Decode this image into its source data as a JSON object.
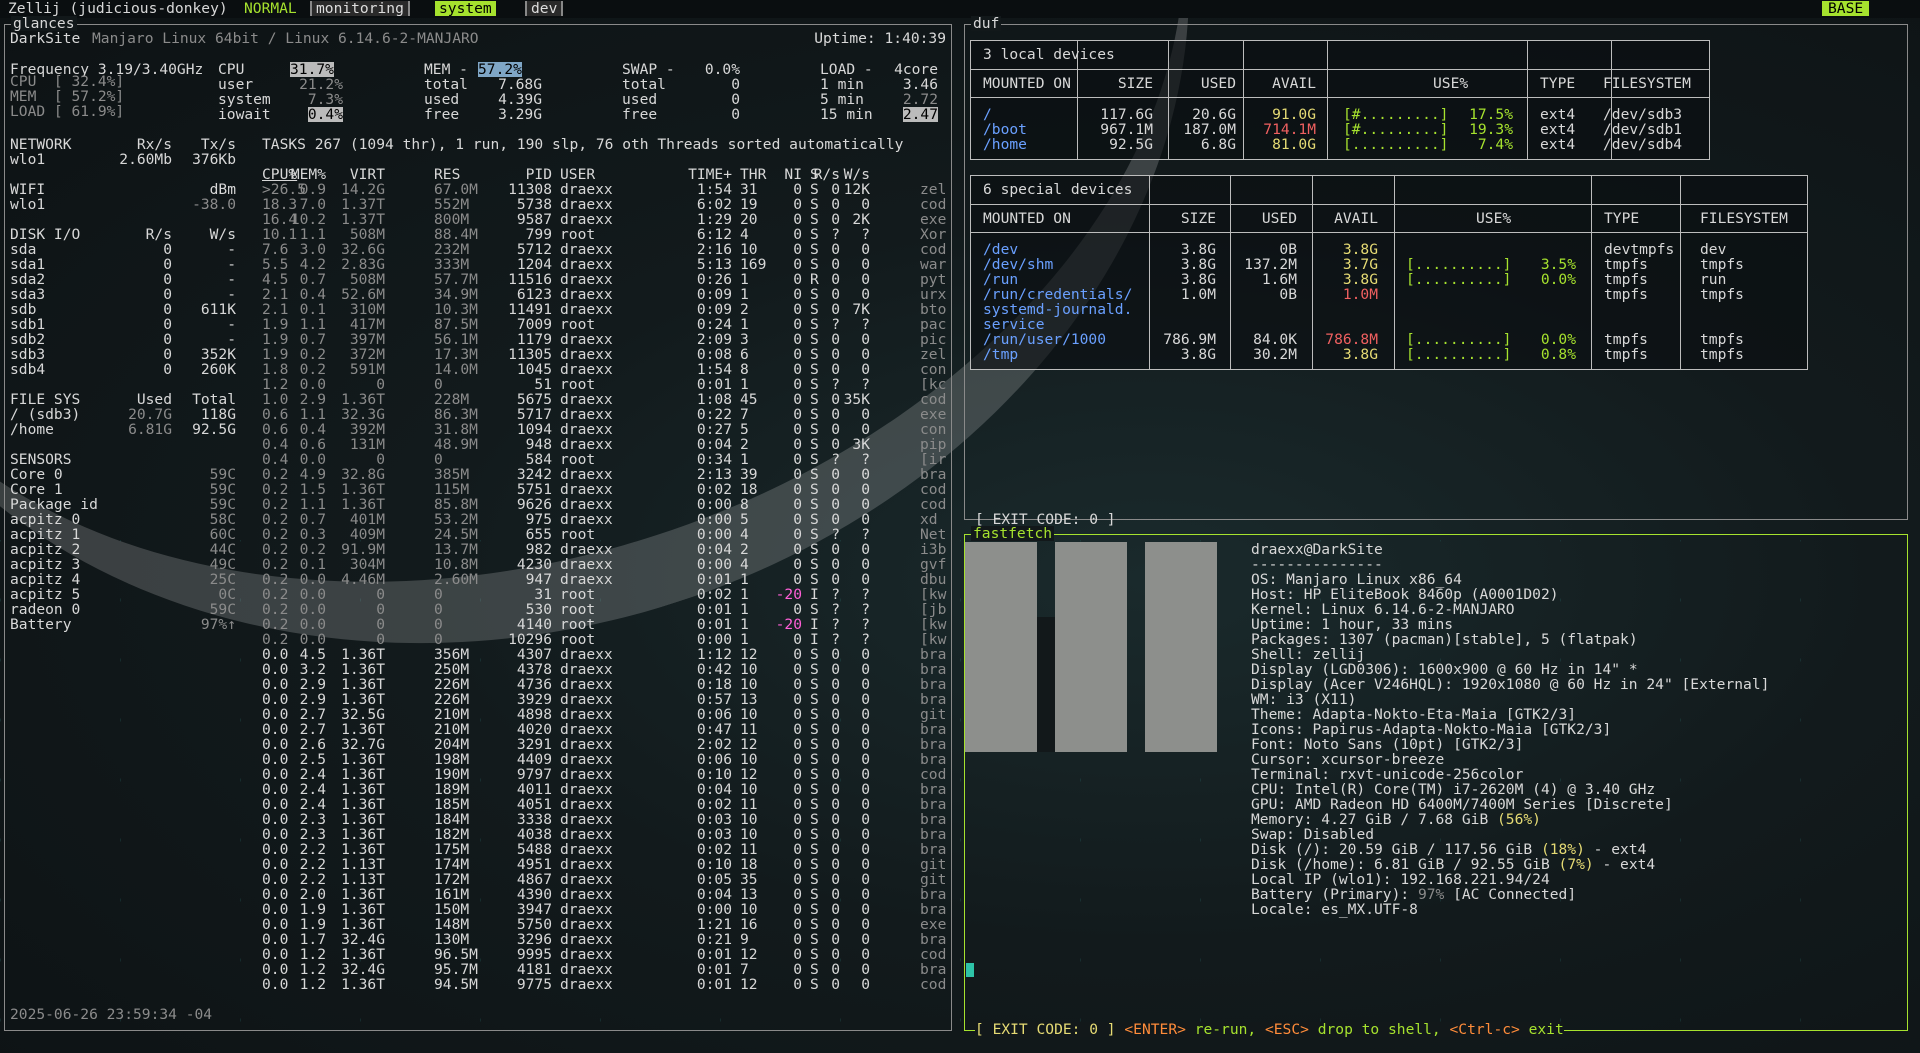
{
  "topbar": {
    "session": "Zellij (judicious-donkey)",
    "mode": "NORMAL",
    "tabs": [
      "monitoring",
      "system",
      "dev"
    ],
    "active_tab": "system",
    "layout_badge": "BASE"
  },
  "panes": {
    "glances": "glances",
    "duf": "duf",
    "fastfetch": "fastfetch",
    "exit_code_top": "[ EXIT CODE: 0 ]",
    "exit_code_bottom": {
      "prefix": "[ EXIT CODE: 0 ]",
      "enter": "<ENTER>",
      "rerun": " re-run, ",
      "esc": "<ESC>",
      "drop": " drop to shell, ",
      "ctrlc": "<Ctrl-c>",
      "exit": " exit"
    }
  },
  "glances": {
    "header_left": "DarkSite",
    "header_os": "Manjaro Linux 64bit / Linux 6.14.6-2-MANJARO",
    "uptime": "Uptime: 1:40:39",
    "quicklook": [
      {
        "label": "Frequency 3.19/3.40GHz"
      },
      {
        "label": "CPU  [ 32.4%]"
      },
      {
        "label": "MEM  [ 57.2%]"
      },
      {
        "label": "LOAD [ 61.9%]"
      }
    ],
    "cpu": {
      "title": "CPU",
      "value": "31.7%",
      "rows": [
        [
          "user",
          "21.2%"
        ],
        [
          "system",
          "7.3%"
        ],
        [
          "iowait",
          "0.4%"
        ]
      ]
    },
    "mem": {
      "title": "MEM -",
      "value": "57.2%",
      "rows": [
        [
          "total",
          "7.68G"
        ],
        [
          "used",
          "4.39G"
        ],
        [
          "free",
          "3.29G"
        ]
      ]
    },
    "swap": {
      "title": "SWAP -",
      "value": "0.0%",
      "rows": [
        [
          "total",
          "0"
        ],
        [
          "used",
          "0"
        ],
        [
          "free",
          "0"
        ]
      ]
    },
    "load": {
      "title": "LOAD -",
      "cores": "4core",
      "rows": [
        [
          "1 min",
          "3.46"
        ],
        [
          "5 min",
          "2.72"
        ],
        [
          "15 min",
          "2.47"
        ]
      ]
    },
    "network": {
      "title": "NETWORK",
      "rx": "Rx/s",
      "tx": "Tx/s",
      "rows": [
        [
          "wlo1",
          "2.60Mb",
          "376Kb"
        ]
      ]
    },
    "wifi": {
      "title": "WIFI",
      "unit": "dBm",
      "rows": [
        [
          "wlo1",
          "-38.0"
        ]
      ]
    },
    "diskio": {
      "title": "DISK I/O",
      "r": "R/s",
      "w": "W/s",
      "rows": [
        [
          "sda",
          "0",
          "-"
        ],
        [
          "sda1",
          "0",
          "-"
        ],
        [
          "sda2",
          "0",
          "-"
        ],
        [
          "sda3",
          "0",
          "-"
        ],
        [
          "sdb",
          "0",
          "611K"
        ],
        [
          "sdb1",
          "0",
          "-"
        ],
        [
          "sdb2",
          "0",
          "-"
        ],
        [
          "sdb3",
          "0",
          "352K"
        ],
        [
          "sdb4",
          "0",
          "260K"
        ]
      ]
    },
    "filesys": {
      "title": "FILE SYS",
      "used": "Used",
      "total": "Total",
      "rows": [
        [
          "/ (sdb3)",
          "20.7G",
          "118G"
        ],
        [
          "/home",
          "6.81G",
          "92.5G"
        ]
      ]
    },
    "sensors": {
      "title": "SENSORS",
      "rows": [
        [
          "Core 0",
          "59C"
        ],
        [
          "Core 1",
          "59C"
        ],
        [
          "Package id",
          "59C"
        ],
        [
          "acpitz 0",
          "58C"
        ],
        [
          "acpitz 1",
          "60C"
        ],
        [
          "acpitz 2",
          "44C"
        ],
        [
          "acpitz 3",
          "49C"
        ],
        [
          "acpitz 4",
          "25C"
        ],
        [
          "acpitz 5",
          "0C"
        ],
        [
          "radeon 0",
          "59C"
        ],
        [
          "Battery",
          "97%↑"
        ]
      ]
    },
    "datetime": "2025-06-26 23:59:34 -04",
    "tasks_line": "TASKS 267 (1094 thr), 1 run, 190 slp, 76 oth Threads sorted automatically",
    "proc_headers": [
      "CPU%",
      "MEM%",
      "VIRT",
      "RES",
      "PID",
      "USER",
      "TIME+",
      "THR",
      "NI",
      "S",
      "R/s",
      "W/s"
    ],
    "procs": [
      [
        ">26.5",
        "0.9",
        "14.2G",
        "67.0M",
        "11308",
        "draexx",
        "1:54",
        "31",
        "0",
        "S",
        "0",
        "12K",
        "zel"
      ],
      [
        "18.3",
        "7.0",
        "1.37T",
        "552M",
        "5738",
        "draexx",
        "6:02",
        "19",
        "0",
        "S",
        "0",
        "0",
        "cod"
      ],
      [
        "16.4",
        "10.2",
        "1.37T",
        "800M",
        "9587",
        "draexx",
        "1:29",
        "20",
        "0",
        "S",
        "0",
        "2K",
        "exe"
      ],
      [
        "10.1",
        "1.1",
        "508M",
        "88.4M",
        "799",
        "root",
        "6:12",
        "4",
        "0",
        "S",
        "?",
        "?",
        "Xor"
      ],
      [
        "7.6",
        "3.0",
        "32.6G",
        "232M",
        "5712",
        "draexx",
        "2:16",
        "10",
        "0",
        "S",
        "0",
        "0",
        "cod"
      ],
      [
        "5.5",
        "4.2",
        "2.83G",
        "333M",
        "1204",
        "draexx",
        "5:13",
        "169",
        "0",
        "S",
        "0",
        "0",
        "war"
      ],
      [
        "4.5",
        "0.7",
        "508M",
        "57.7M",
        "11516",
        "draexx",
        "0:26",
        "1",
        "0",
        "R",
        "0",
        "0",
        "pyt"
      ],
      [
        "2.1",
        "0.4",
        "52.6M",
        "34.9M",
        "6123",
        "draexx",
        "0:09",
        "1",
        "0",
        "S",
        "0",
        "0",
        "urx"
      ],
      [
        "2.1",
        "0.1",
        "310M",
        "10.3M",
        "11491",
        "draexx",
        "0:09",
        "2",
        "0",
        "S",
        "0",
        "7K",
        "bto"
      ],
      [
        "1.9",
        "1.1",
        "417M",
        "87.5M",
        "7009",
        "root",
        "0:24",
        "1",
        "0",
        "S",
        "?",
        "?",
        "pac"
      ],
      [
        "1.9",
        "0.7",
        "397M",
        "56.1M",
        "1179",
        "draexx",
        "2:09",
        "3",
        "0",
        "S",
        "0",
        "0",
        "pic"
      ],
      [
        "1.9",
        "0.2",
        "372M",
        "17.3M",
        "11305",
        "draexx",
        "0:08",
        "6",
        "0",
        "S",
        "0",
        "0",
        "zel"
      ],
      [
        "1.8",
        "0.2",
        "591M",
        "14.0M",
        "1045",
        "draexx",
        "1:54",
        "8",
        "0",
        "S",
        "0",
        "0",
        "con"
      ],
      [
        "1.2",
        "0.0",
        "0",
        "0",
        "51",
        "root",
        "0:01",
        "1",
        "0",
        "S",
        "?",
        "?",
        "[kc"
      ],
      [
        "1.0",
        "2.9",
        "1.36T",
        "228M",
        "5675",
        "draexx",
        "1:08",
        "45",
        "0",
        "S",
        "0",
        "35K",
        "cod"
      ],
      [
        "0.6",
        "1.1",
        "32.3G",
        "86.3M",
        "5717",
        "draexx",
        "0:22",
        "7",
        "0",
        "S",
        "0",
        "0",
        "exe"
      ],
      [
        "0.6",
        "0.4",
        "392M",
        "31.8M",
        "1094",
        "draexx",
        "0:27",
        "5",
        "0",
        "S",
        "0",
        "0",
        "con"
      ],
      [
        "0.4",
        "0.6",
        "131M",
        "48.9M",
        "948",
        "draexx",
        "0:04",
        "2",
        "0",
        "S",
        "0",
        "3K",
        "pip"
      ],
      [
        "0.4",
        "0.0",
        "0",
        "0",
        "584",
        "root",
        "0:34",
        "1",
        "0",
        "S",
        "?",
        "?",
        "[ir"
      ],
      [
        "0.2",
        "4.9",
        "32.8G",
        "385M",
        "3242",
        "draexx",
        "2:13",
        "39",
        "0",
        "S",
        "0",
        "0",
        "bra"
      ],
      [
        "0.2",
        "1.5",
        "1.36T",
        "115M",
        "5751",
        "draexx",
        "0:02",
        "18",
        "0",
        "S",
        "0",
        "0",
        "cod"
      ],
      [
        "0.2",
        "1.1",
        "1.36T",
        "85.8M",
        "9626",
        "draexx",
        "0:00",
        "8",
        "0",
        "S",
        "0",
        "0",
        "cod"
      ],
      [
        "0.2",
        "0.7",
        "401M",
        "53.2M",
        "975",
        "draexx",
        "0:00",
        "5",
        "0",
        "S",
        "0",
        "0",
        "xd"
      ],
      [
        "0.2",
        "0.3",
        "409M",
        "24.5M",
        "655",
        "root",
        "0:00",
        "4",
        "0",
        "S",
        "?",
        "?",
        "Net"
      ],
      [
        "0.2",
        "0.2",
        "91.9M",
        "13.7M",
        "982",
        "draexx",
        "0:04",
        "2",
        "0",
        "S",
        "0",
        "0",
        "i3b"
      ],
      [
        "0.2",
        "0.1",
        "304M",
        "10.8M",
        "4230",
        "draexx",
        "0:00",
        "4",
        "0",
        "S",
        "0",
        "0",
        "gvf"
      ],
      [
        "0.2",
        "0.0",
        "4.46M",
        "2.60M",
        "947",
        "draexx",
        "0:01",
        "1",
        "0",
        "S",
        "0",
        "0",
        "dbu"
      ],
      [
        "0.2",
        "0.0",
        "0",
        "0",
        "31",
        "root",
        "0:02",
        "1",
        "-20",
        "I",
        "?",
        "?",
        "[kw"
      ],
      [
        "0.2",
        "0.0",
        "0",
        "0",
        "530",
        "root",
        "0:01",
        "1",
        "0",
        "S",
        "?",
        "?",
        "[jb"
      ],
      [
        "0.2",
        "0.0",
        "0",
        "0",
        "4140",
        "root",
        "0:01",
        "1",
        "-20",
        "I",
        "?",
        "?",
        "[kw"
      ],
      [
        "0.2",
        "0.0",
        "0",
        "0",
        "10296",
        "root",
        "0:00",
        "1",
        "0",
        "I",
        "?",
        "?",
        "[kw"
      ],
      [
        "0.0",
        "4.5",
        "1.36T",
        "356M",
        "4307",
        "draexx",
        "1:12",
        "12",
        "0",
        "S",
        "0",
        "0",
        "bra"
      ],
      [
        "0.0",
        "3.2",
        "1.36T",
        "250M",
        "4378",
        "draexx",
        "0:42",
        "10",
        "0",
        "S",
        "0",
        "0",
        "bra"
      ],
      [
        "0.0",
        "2.9",
        "1.36T",
        "226M",
        "4736",
        "draexx",
        "0:18",
        "10",
        "0",
        "S",
        "0",
        "0",
        "bra"
      ],
      [
        "0.0",
        "2.9",
        "1.36T",
        "226M",
        "3929",
        "draexx",
        "0:57",
        "13",
        "0",
        "S",
        "0",
        "0",
        "bra"
      ],
      [
        "0.0",
        "2.7",
        "32.5G",
        "210M",
        "4898",
        "draexx",
        "0:06",
        "10",
        "0",
        "S",
        "0",
        "0",
        "git"
      ],
      [
        "0.0",
        "2.7",
        "1.36T",
        "210M",
        "4020",
        "draexx",
        "0:47",
        "11",
        "0",
        "S",
        "0",
        "0",
        "bra"
      ],
      [
        "0.0",
        "2.6",
        "32.7G",
        "204M",
        "3291",
        "draexx",
        "2:02",
        "12",
        "0",
        "S",
        "0",
        "0",
        "bra"
      ],
      [
        "0.0",
        "2.5",
        "1.36T",
        "198M",
        "4409",
        "draexx",
        "0:06",
        "10",
        "0",
        "S",
        "0",
        "0",
        "bra"
      ],
      [
        "0.0",
        "2.4",
        "1.36T",
        "190M",
        "9797",
        "draexx",
        "0:10",
        "12",
        "0",
        "S",
        "0",
        "0",
        "cod"
      ],
      [
        "0.0",
        "2.4",
        "1.36T",
        "189M",
        "4011",
        "draexx",
        "0:04",
        "10",
        "0",
        "S",
        "0",
        "0",
        "bra"
      ],
      [
        "0.0",
        "2.4",
        "1.36T",
        "185M",
        "4051",
        "draexx",
        "0:02",
        "11",
        "0",
        "S",
        "0",
        "0",
        "bra"
      ],
      [
        "0.0",
        "2.3",
        "1.36T",
        "184M",
        "3338",
        "draexx",
        "0:03",
        "10",
        "0",
        "S",
        "0",
        "0",
        "bra"
      ],
      [
        "0.0",
        "2.3",
        "1.36T",
        "182M",
        "4038",
        "draexx",
        "0:03",
        "10",
        "0",
        "S",
        "0",
        "0",
        "bra"
      ],
      [
        "0.0",
        "2.2",
        "1.36T",
        "175M",
        "5488",
        "draexx",
        "0:02",
        "11",
        "0",
        "S",
        "0",
        "0",
        "bra"
      ],
      [
        "0.0",
        "2.2",
        "1.13T",
        "174M",
        "4951",
        "draexx",
        "0:10",
        "18",
        "0",
        "S",
        "0",
        "0",
        "git"
      ],
      [
        "0.0",
        "2.2",
        "1.13T",
        "172M",
        "4867",
        "draexx",
        "0:05",
        "35",
        "0",
        "S",
        "0",
        "0",
        "git"
      ],
      [
        "0.0",
        "2.0",
        "1.36T",
        "161M",
        "4390",
        "draexx",
        "0:04",
        "13",
        "0",
        "S",
        "0",
        "0",
        "bra"
      ],
      [
        "0.0",
        "1.9",
        "1.36T",
        "150M",
        "3947",
        "draexx",
        "0:00",
        "10",
        "0",
        "S",
        "0",
        "0",
        "bra"
      ],
      [
        "0.0",
        "1.9",
        "1.36T",
        "148M",
        "5750",
        "draexx",
        "1:21",
        "16",
        "0",
        "S",
        "0",
        "0",
        "exe"
      ],
      [
        "0.0",
        "1.7",
        "32.4G",
        "130M",
        "3296",
        "draexx",
        "0:21",
        "9",
        "0",
        "S",
        "0",
        "0",
        "bra"
      ],
      [
        "0.0",
        "1.2",
        "1.36T",
        "96.5M",
        "9995",
        "draexx",
        "0:01",
        "12",
        "0",
        "S",
        "0",
        "0",
        "cod"
      ],
      [
        "0.0",
        "1.2",
        "32.4G",
        "95.7M",
        "4181",
        "draexx",
        "0:01",
        "7",
        "0",
        "S",
        "0",
        "0",
        "bra"
      ],
      [
        "0.0",
        "1.2",
        "1.36T",
        "94.5M",
        "9775",
        "draexx",
        "0:01",
        "12",
        "0",
        "S",
        "0",
        "0",
        "cod"
      ]
    ]
  },
  "duf": {
    "local_title": "3 local devices",
    "special_title": "6 special devices",
    "headers": [
      "MOUNTED ON",
      "SIZE",
      "USED",
      "AVAIL",
      "USE%",
      "TYPE",
      "FILESYSTEM"
    ],
    "local": [
      [
        "/",
        "117.6G",
        "20.6G",
        "91.0G",
        "[#.........]",
        "17.5%",
        "ext4",
        "/dev/sdb3"
      ],
      [
        "/boot",
        "967.1M",
        "187.0M",
        "714.1M",
        "[#.........]",
        "19.3%",
        "ext4",
        "/dev/sdb1"
      ],
      [
        "/home",
        "92.5G",
        "6.8G",
        "81.0G",
        "[..........]",
        "7.4%",
        "ext4",
        "/dev/sdb4"
      ]
    ],
    "special": [
      [
        "/dev",
        "3.8G",
        "0B",
        "3.8G",
        "",
        "",
        "devtmpfs",
        "dev"
      ],
      [
        "/dev/shm",
        "3.8G",
        "137.2M",
        "3.7G",
        "[..........]",
        "3.5%",
        "tmpfs",
        "tmpfs"
      ],
      [
        "/run",
        "3.8G",
        "1.6M",
        "3.8G",
        "[..........]",
        "0.0%",
        "tmpfs",
        "run"
      ],
      [
        "/run/credentials/",
        "1.0M",
        "0B",
        "1.0M",
        "",
        "",
        "tmpfs",
        "tmpfs"
      ],
      [
        "systemd-journald.",
        "",
        "",
        "",
        "",
        "",
        "",
        ""
      ],
      [
        "service",
        "",
        "",
        "",
        "",
        "",
        "",
        ""
      ],
      [
        "/run/user/1000",
        "786.9M",
        "84.0K",
        "786.8M",
        "[..........]",
        "0.0%",
        "tmpfs",
        "tmpfs"
      ],
      [
        "/tmp",
        "3.8G",
        "30.2M",
        "3.8G",
        "[..........]",
        "0.8%",
        "tmpfs",
        "tmpfs"
      ]
    ]
  },
  "fastfetch": {
    "userhost": "draexx@DarkSite",
    "separator": "---------------",
    "lines": [
      [
        "OS",
        ": Manjaro Linux x86_64"
      ],
      [
        "Host",
        ": HP EliteBook 8460p (A0001D02)"
      ],
      [
        "Kernel",
        ": Linux 6.14.6-2-MANJARO"
      ],
      [
        "Uptime",
        ": 1 hour, 33 mins"
      ],
      [
        "Packages",
        ": 1307 (pacman)[stable], 5 (flatpak)"
      ],
      [
        "Shell",
        ": zellij"
      ],
      [
        "Display (LGD0306)",
        ": 1600x900 @ 60 Hz in 14\" *"
      ],
      [
        "Display (Acer V246HQL)",
        ": 1920x1080 @ 60 Hz in 24\" [External]"
      ],
      [
        "WM",
        ": i3 (X11)"
      ],
      [
        "Theme",
        ": Adapta-Nokto-Eta-Maia [GTK2/3]"
      ],
      [
        "Icons",
        ": Papirus-Adapta-Nokto-Maia [GTK2/3]"
      ],
      [
        "Font",
        ": Noto Sans (10pt) [GTK2/3]"
      ],
      [
        "Cursor",
        ": xcursor-breeze"
      ],
      [
        "Terminal",
        ": rxvt-unicode-256color"
      ],
      [
        "CPU",
        ": Intel(R) Core(TM) i7-2620M (4) @ 3.40 GHz"
      ],
      [
        "GPU",
        ": AMD Radeon HD 6400M/7400M Series [Discrete]"
      ],
      [
        "Memory",
        ": 4.27 GiB / 7.68 GiB (56%)"
      ],
      [
        "Swap",
        ": Disabled"
      ],
      [
        "Disk (/)",
        ": 20.59 GiB / 117.56 GiB (18%) - ext4"
      ],
      [
        "Disk (/home)",
        ": 6.81 GiB / 92.55 GiB (7%) - ext4"
      ],
      [
        "Local IP (wlo1)",
        ": 192.168.221.94/24"
      ],
      [
        "Battery (Primary)",
        ": 97% [AC Connected]"
      ],
      [
        "Locale",
        ": es_MX.UTF-8"
      ]
    ]
  }
}
